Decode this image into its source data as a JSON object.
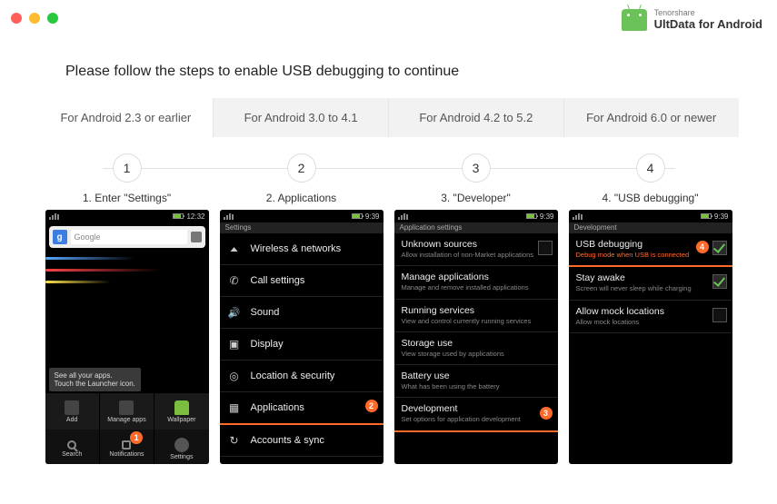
{
  "brand": {
    "small": "Tenorshare",
    "big": "UltData for Android"
  },
  "instruction": "Please follow the steps to enable USB debugging to continue",
  "tabs": {
    "t0": "For Android 2.3 or earlier",
    "t1": "For Android 3.0 to 4.1",
    "t2": "For Android 4.2 to 5.2",
    "t3": "For Android 6.0 or newer"
  },
  "steps": {
    "s1": {
      "num": "1",
      "title": "1. Enter \"Settings\""
    },
    "s2": {
      "num": "2",
      "title": "2. Applications"
    },
    "s3": {
      "num": "3",
      "title": "3. \"Developer\""
    },
    "s4": {
      "num": "4",
      "title": "4. \"USB debugging\""
    }
  },
  "phone1": {
    "time": "12:32",
    "search_placeholder": "Google",
    "hint": "See all your apps.\nTouch the Launcher icon.",
    "widgets": {
      "add": "Add",
      "manage": "Manage apps",
      "wallpaper": "Wallpaper"
    },
    "launcher": {
      "search": "Search",
      "notifications": "Notifications",
      "settings": "Settings"
    },
    "badge": "1"
  },
  "phone2": {
    "time": "9:39",
    "header": "Settings",
    "rows": {
      "wifi": "Wireless & networks",
      "call": "Call settings",
      "sound": "Sound",
      "display": "Display",
      "loc": "Location & security",
      "apps": "Applications",
      "sync": "Accounts & sync"
    },
    "badge": "2"
  },
  "phone3": {
    "time": "9:39",
    "header": "Application settings",
    "rows": {
      "unknown": {
        "t": "Unknown sources",
        "s": "Allow installation of non-Market applications"
      },
      "manage": {
        "t": "Manage applications",
        "s": "Manage and remove installed applications"
      },
      "running": {
        "t": "Running services",
        "s": "View and control currently running services"
      },
      "storage": {
        "t": "Storage use",
        "s": "View storage used by applications"
      },
      "battery": {
        "t": "Battery use",
        "s": "What has been using the battery"
      },
      "dev": {
        "t": "Development",
        "s": "Set options for application development"
      }
    },
    "badge": "3"
  },
  "phone4": {
    "time": "9:39",
    "header": "Development",
    "rows": {
      "usb": {
        "t": "USB debugging",
        "s": "Debug mode when USB is connected"
      },
      "stay": {
        "t": "Stay awake",
        "s": "Screen will never sleep while charging"
      },
      "mock": {
        "t": "Allow mock locations",
        "s": "Allow mock locations"
      }
    },
    "badge": "4"
  }
}
